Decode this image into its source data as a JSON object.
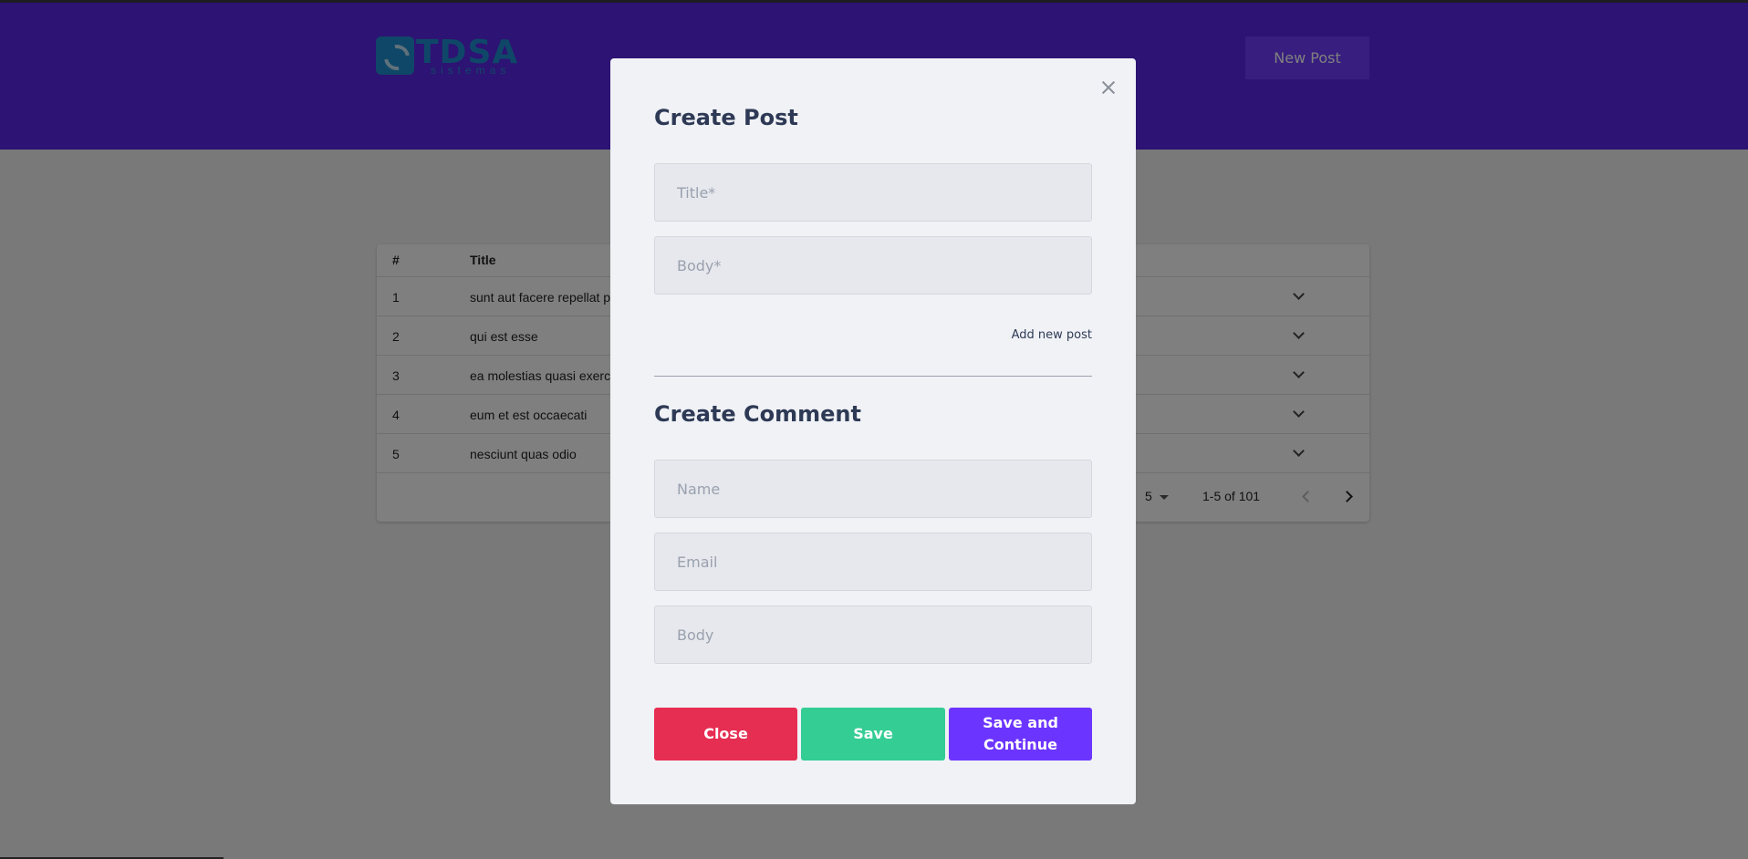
{
  "header": {
    "logo_text": "TDSA",
    "logo_sub": "sistemas",
    "new_post_label": "New Post"
  },
  "table": {
    "columns": [
      "#",
      "Title"
    ],
    "rows": [
      {
        "num": "1",
        "title": "sunt aut facere repellat p"
      },
      {
        "num": "2",
        "title": "qui est esse"
      },
      {
        "num": "3",
        "title": "ea molestias quasi exerc"
      },
      {
        "num": "4",
        "title": "eum et est occaecati"
      },
      {
        "num": "5",
        "title": "nesciunt quas odio"
      }
    ],
    "pagination": {
      "rows_per_page": "5",
      "range": "1-5 of 101"
    }
  },
  "modal": {
    "post_heading": "Create Post",
    "title_placeholder": "Title*",
    "body_placeholder": "Body*",
    "add_new_post": "Add new post",
    "comment_heading": "Create Comment",
    "name_placeholder": "Name",
    "email_placeholder": "Email",
    "comment_body_placeholder": "Body",
    "close_label": "Close",
    "save_label": "Save",
    "save_continue_label": "Save and Continue"
  },
  "colors": {
    "header": "#5b27e6",
    "close": "#e62e52",
    "save": "#34cd94",
    "save_continue": "#6c35ff"
  }
}
